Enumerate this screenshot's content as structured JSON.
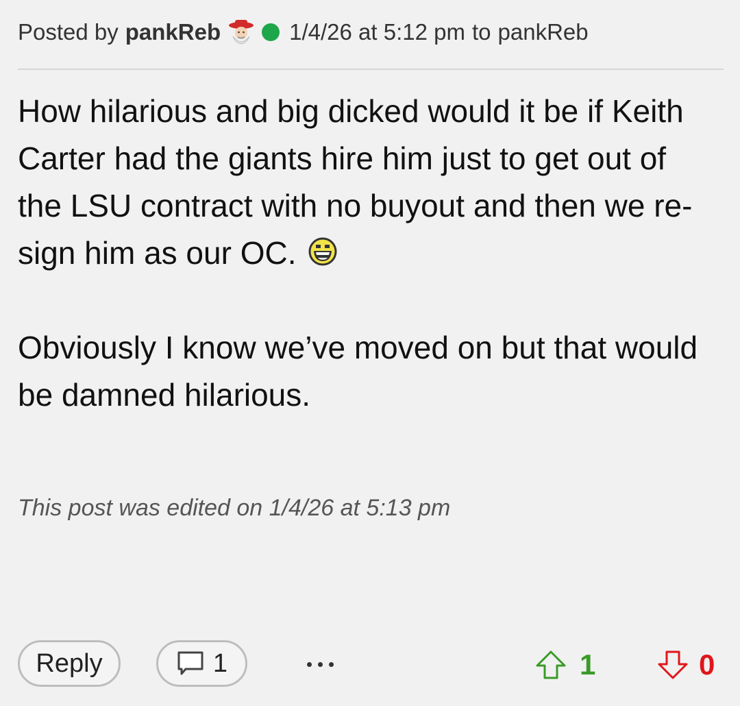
{
  "header": {
    "posted_by": "Posted by",
    "username": "pankReb",
    "timestamp": "1/4/26 at 5:12 pm",
    "to_text": "to",
    "recipient": "pankReb",
    "online_color": "#1ea64a",
    "flair_icon": "rebel-mascot-icon"
  },
  "body": {
    "paragraph1": "How hilarious and big dicked would it be if Keith Carter had the giants hire him just to get out of the LSU contract with no buyout and then we re-sign him as our OC.",
    "emoji_icon": "grinning-emoji-icon",
    "paragraph2": "Obviously I know we’ve moved on but that would be damned hilarious."
  },
  "edited_note": "This post was edited on 1/4/26 at 5:13 pm",
  "actions": {
    "reply_label": "Reply",
    "comment_count": "1",
    "more_icon": "ellipsis-icon",
    "upvote_count": "1",
    "downvote_count": "0",
    "upvote_color": "#3a9a28",
    "downvote_color": "#e0161b"
  }
}
